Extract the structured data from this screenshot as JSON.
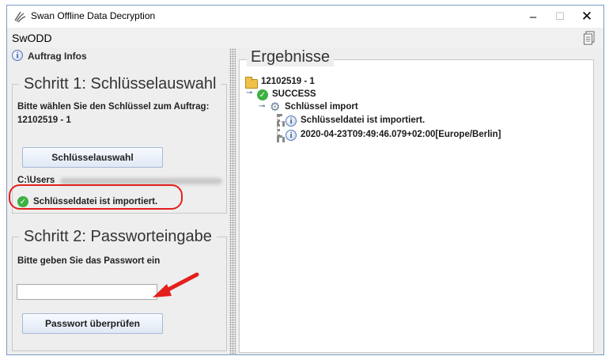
{
  "window": {
    "title": "Swan Offline Data Decryption",
    "app_name": "SwODD",
    "controls": {
      "minimize": "–",
      "maximize": "☐",
      "close": "✕"
    }
  },
  "left": {
    "auftrag_infos": "Auftrag Infos",
    "step1": {
      "title": "Schritt 1: Schlüsselauswahl",
      "instruction_line1": "Bitte wählen Sie den Schlüssel zum Auftrag:",
      "instruction_line2": "12102519 - 1",
      "button_label": "Schlüsselauswahl",
      "path_prefix": "C:\\Users",
      "status_text": "Schlüsseldatei ist importiert."
    },
    "step2": {
      "title": "Schritt 2: Passworteingabe",
      "instruction": "Bitte geben Sie das Passwort ein",
      "password_value": "",
      "button_label": "Passwort überprüfen"
    }
  },
  "results": {
    "title": "Ergebnisse",
    "tree": {
      "root": "12102519 - 1",
      "status": "SUCCESS",
      "section": "Schlüssel import",
      "items": [
        "Schlüsseldatei ist importiert.",
        "2020-04-23T09:49:46.079+02:00[Europe/Berlin]"
      ]
    }
  },
  "colors": {
    "highlight": "#e3201c",
    "success": "#3cb043",
    "arrow": "#e3201c"
  },
  "icons": [
    "swan-app-icon",
    "document-icon",
    "info-icon",
    "folder-icon",
    "check-icon",
    "gear-icon"
  ]
}
